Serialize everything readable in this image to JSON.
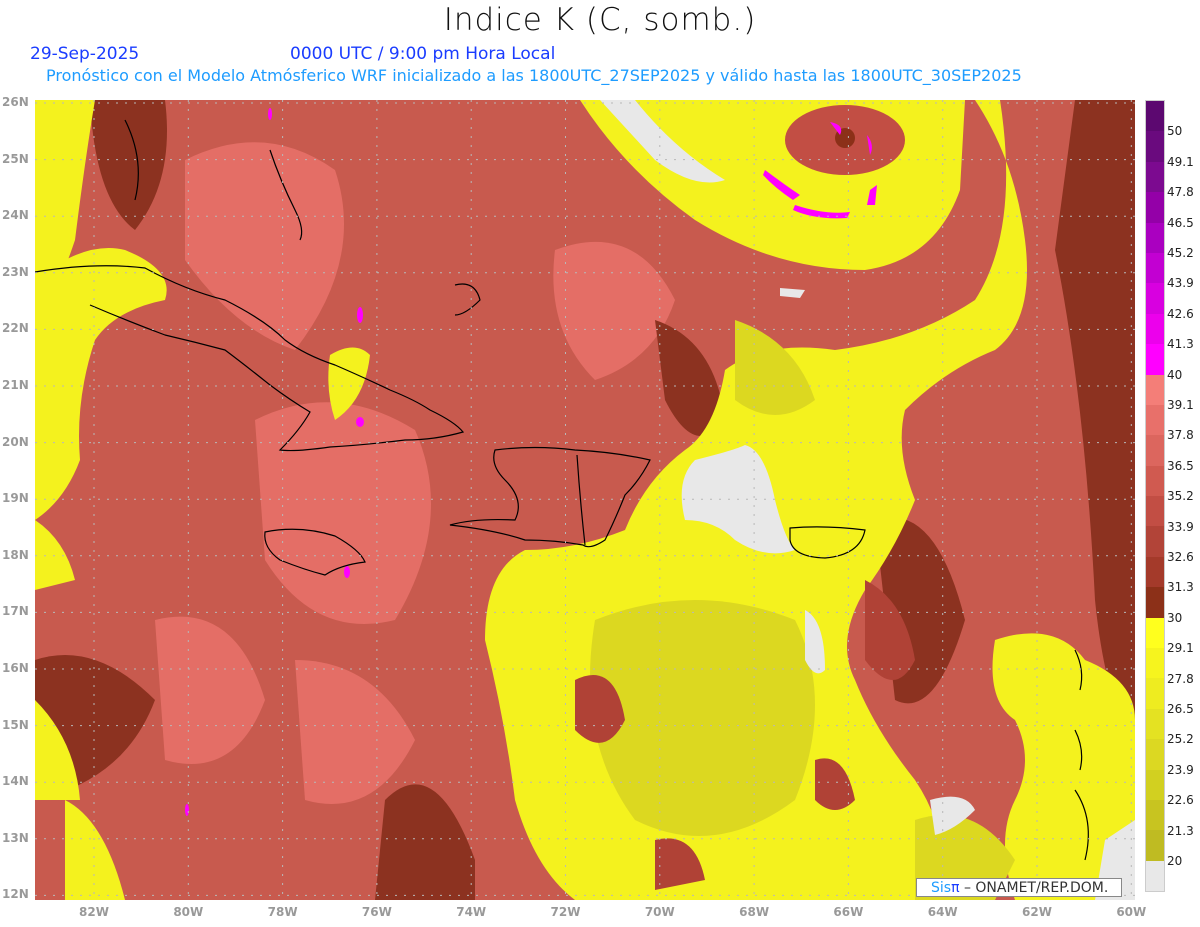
{
  "header": {
    "title": "Indice K (C, somb.)",
    "date": "29-Sep-2025",
    "time": "0000 UTC / 9:00 pm Hora Local",
    "subtitle": "Pronóstico con el Modelo Atmósferico WRF inicializado a las 1800UTC_27SEP2025 y válido hasta las  1800UTC_30SEP2025"
  },
  "axes": {
    "lat_labels": [
      "26N",
      "25N",
      "24N",
      "23N",
      "22N",
      "21N",
      "20N",
      "19N",
      "18N",
      "17N",
      "16N",
      "15N",
      "14N",
      "13N",
      "12N"
    ],
    "lon_labels": [
      "82W",
      "80W",
      "78W",
      "76W",
      "74W",
      "72W",
      "70W",
      "68W",
      "66W",
      "64W",
      "62W",
      "60W"
    ]
  },
  "colorbar": {
    "labels": [
      "50",
      "49.1",
      "47.8",
      "46.5",
      "45.2",
      "43.9",
      "42.6",
      "41.3",
      "40",
      "39.1",
      "37.8",
      "36.5",
      "35.2",
      "33.9",
      "32.6",
      "31.3",
      "30",
      "29.1",
      "27.8",
      "26.5",
      "25.2",
      "23.9",
      "22.6",
      "21.3",
      "20"
    ],
    "colors": [
      "#5c0870",
      "#6a0a7e",
      "#7c0a90",
      "#9400a8",
      "#aa00c0",
      "#c200d2",
      "#d800e0",
      "#ec00ec",
      "#ff00ff",
      "#f47e78",
      "#e8706a",
      "#dc665e",
      "#d05a50",
      "#c24e44",
      "#b24438",
      "#a43a2a",
      "#8c3018",
      "#ffff1e",
      "#f6f41e",
      "#eeec20",
      "#e4e222",
      "#dcd822",
      "#d2d020",
      "#c8c420",
      "#bfbb22",
      "#e8e8e8"
    ]
  },
  "credit": {
    "brand_a": "Sis",
    "brand_b": "π",
    "text": " – ONAMET/REP.DOM."
  }
}
